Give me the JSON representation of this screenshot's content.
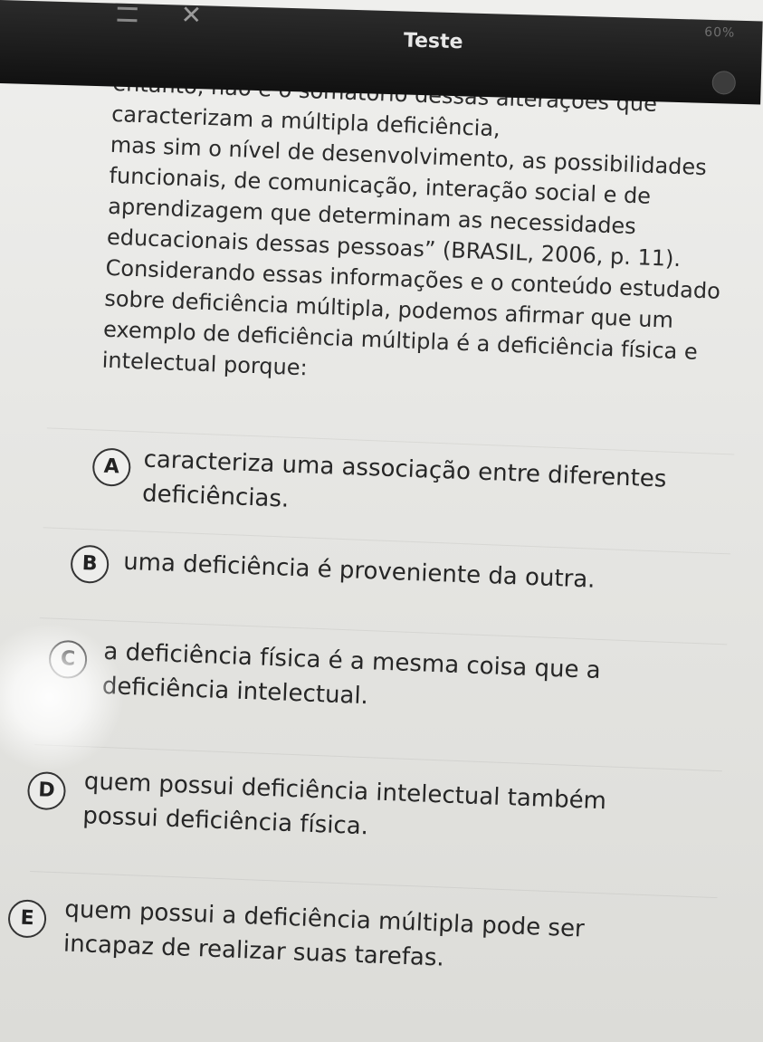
{
  "header": {
    "title": "Teste",
    "status_text": "60%"
  },
  "question": {
    "text": "mental, emocional ou de comportamento social. No\nentanto, não é o somatório dessas alterações que\ncaracterizam a múltipla deficiência,\nmas sim o nível de desenvolvimento, as possibilidades\nfuncionais, de comunicação, interação social e de\naprendizagem que determinam as necessidades\neducacionais dessas pessoas” (BRASIL, 2006, p. 11).\nConsiderando essas informações e o conteúdo estudado\nsobre deficiência múltipla, podemos afirmar que um\nexemplo de deficiência múltipla é a deficiência física e\nintelectual porque:"
  },
  "options": [
    {
      "letter": "A",
      "text": "caracteriza uma associação entre diferentes\ndeficiências."
    },
    {
      "letter": "B",
      "text": "uma deficiência é proveniente da outra."
    },
    {
      "letter": "C",
      "text": "a deficiência física é a mesma coisa que a\ndeficiência intelectual."
    },
    {
      "letter": "D",
      "text": "quem possui deficiência intelectual também\npossui deficiência física."
    },
    {
      "letter": "E",
      "text": "quem possui a deficiência múltipla pode ser\nincapaz de realizar suas tarefas."
    }
  ],
  "icons": {
    "menu": "menu-icon",
    "close": "close-icon",
    "info": "info-icon"
  }
}
